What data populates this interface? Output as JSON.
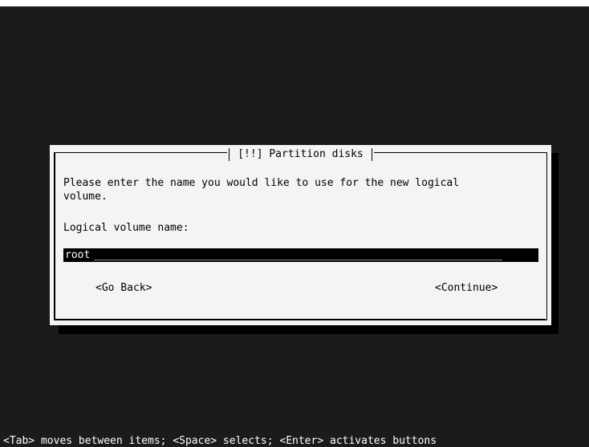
{
  "dialog": {
    "title": "[!!] Partition disks",
    "message_line1": "Please enter the name you would like to use for the new logical",
    "message_line2": "volume.",
    "field_label": "Logical volume name:",
    "field_value": "root",
    "field_fill": "_________________________________________________________________",
    "go_back_label": "<Go Back>",
    "continue_label": "<Continue>"
  },
  "status_bar": {
    "help_text": "<Tab> moves between items; <Space> selects; <Enter> activates buttons"
  }
}
